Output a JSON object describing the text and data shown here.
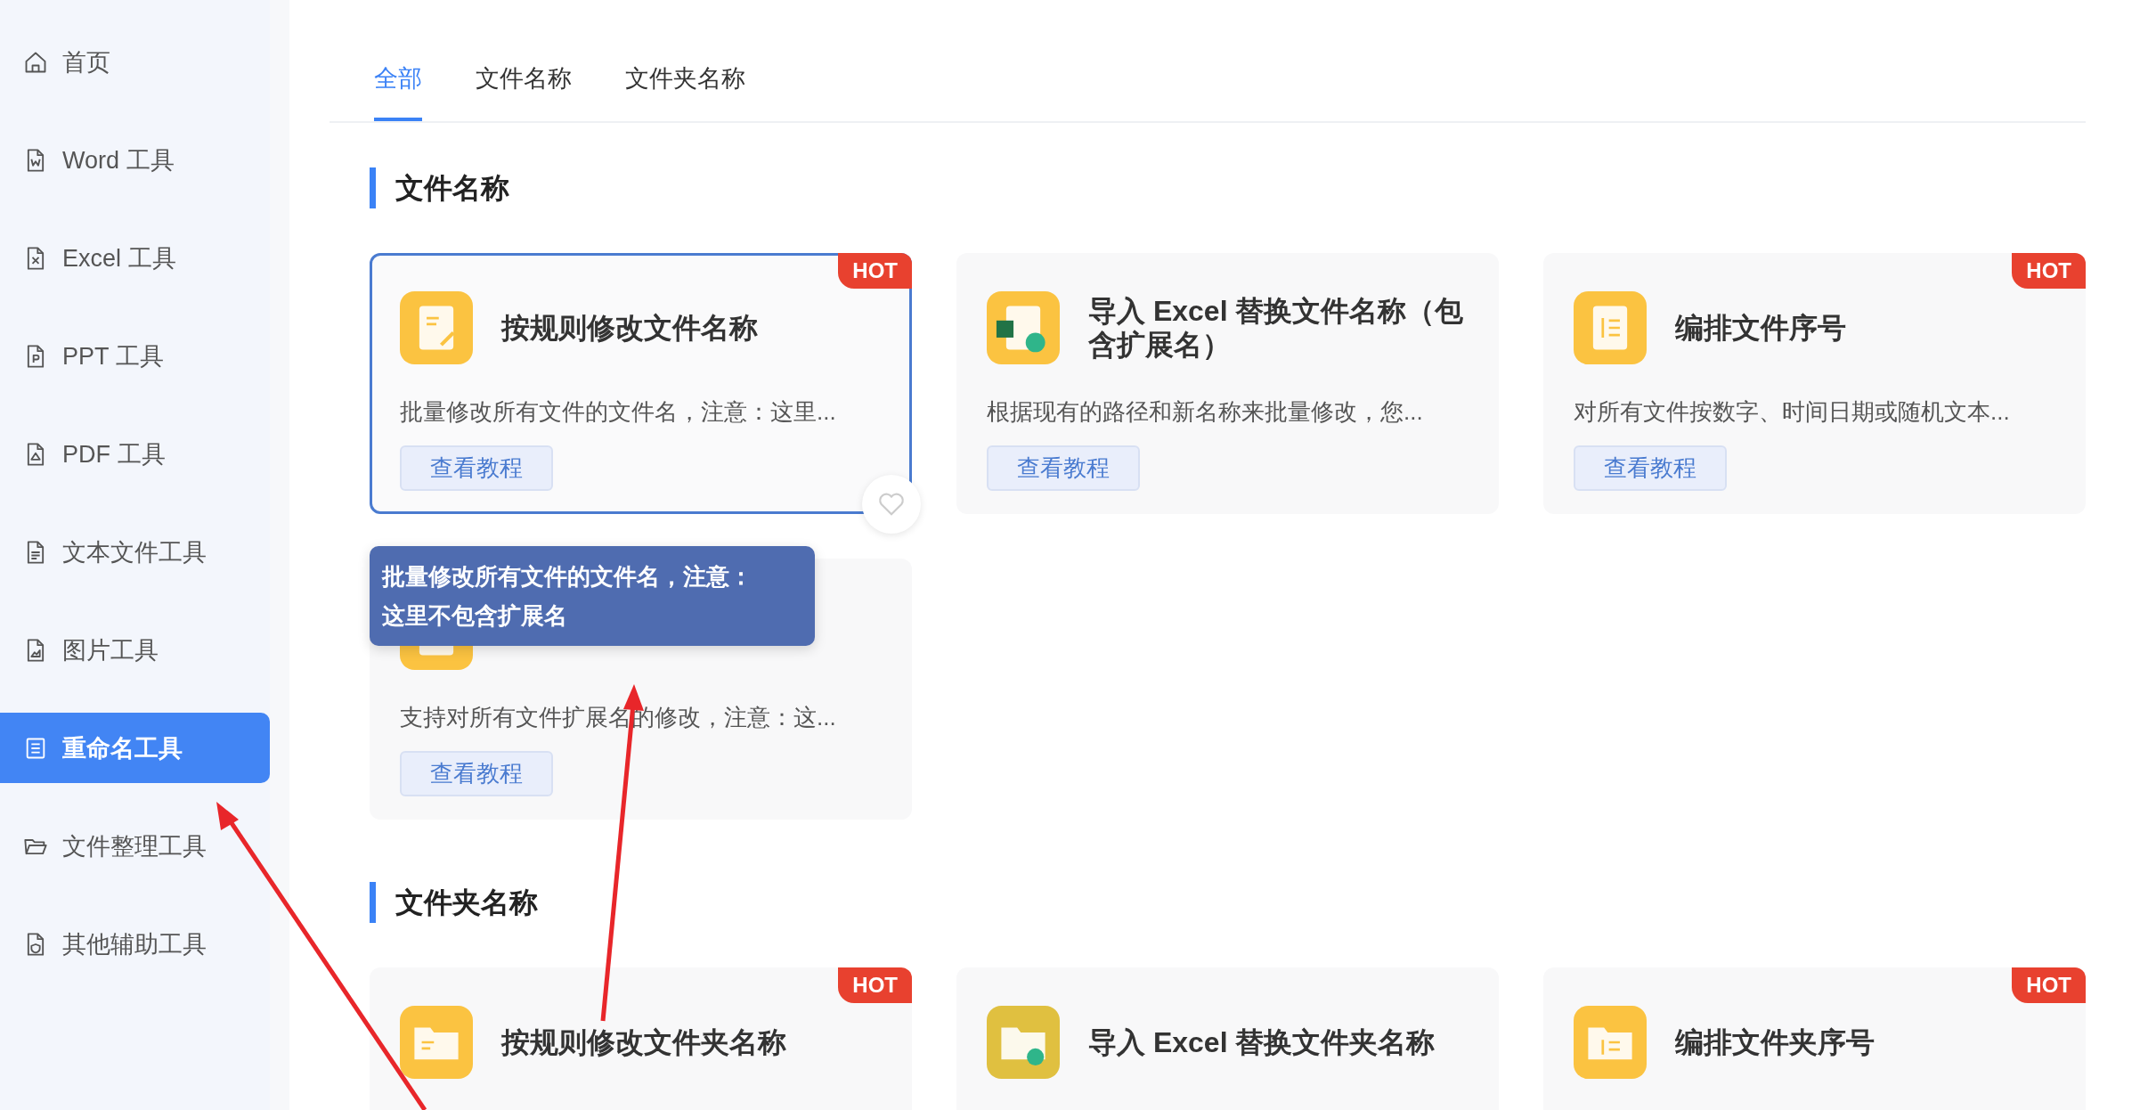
{
  "sidebar": {
    "items": [
      {
        "label": "首页",
        "kind": "home",
        "selected": false
      },
      {
        "label": "Word 工具",
        "kind": "word",
        "selected": false
      },
      {
        "label": "Excel 工具",
        "kind": "excel",
        "selected": false
      },
      {
        "label": "PPT 工具",
        "kind": "ppt",
        "selected": false
      },
      {
        "label": "PDF 工具",
        "kind": "pdf",
        "selected": false
      },
      {
        "label": "文本文件工具",
        "kind": "text",
        "selected": false
      },
      {
        "label": "图片工具",
        "kind": "image",
        "selected": false
      },
      {
        "label": "重命名工具",
        "kind": "list",
        "selected": true
      },
      {
        "label": "文件整理工具",
        "kind": "folder",
        "selected": false
      },
      {
        "label": "其他辅助工具",
        "kind": "shield",
        "selected": false
      }
    ]
  },
  "tabs": [
    {
      "label": "全部",
      "selected": true
    },
    {
      "label": "文件名称",
      "selected": false
    },
    {
      "label": "文件夹名称",
      "selected": false
    }
  ],
  "sections": [
    {
      "title": "文件名称",
      "cards": [
        {
          "kind": "edit",
          "badge": "HOT",
          "title": "按规则修改文件名称",
          "description": "批量修改所有文件的文件名，注意：这里...",
          "button": "查看教程",
          "highlighted": true,
          "tooltip": "批量修改所有文件的文件名，注意：这里不包含扩展名"
        },
        {
          "kind": "excel",
          "title": "导入 Excel 替换文件名称（包含扩展名）",
          "description": "根据现有的路径和新名称来批量修改，您...",
          "button": "查看教程",
          "highlighted": false
        },
        {
          "kind": "number",
          "badge": "HOT",
          "title": "编排文件序号",
          "description": "对所有文件按数字、时间日期或随机文本...",
          "button": "查看教程",
          "highlighted": false
        },
        {
          "kind": "ext",
          "description": "支持对所有文件扩展名的修改，注意：这...",
          "button": "查看教程",
          "highlighted": false
        }
      ]
    },
    {
      "title": "文件夹名称",
      "cards": [
        {
          "kind": "folder-edit",
          "badge": "HOT",
          "title": "按规则修改文件夹名称",
          "highlighted": false
        },
        {
          "kind": "folder-excel",
          "title": "导入 Excel 替换文件夹名称",
          "highlighted": false
        },
        {
          "kind": "folder-number",
          "badge": "HOT",
          "title": "编排文件夹序号",
          "highlighted": false
        }
      ]
    }
  ]
}
